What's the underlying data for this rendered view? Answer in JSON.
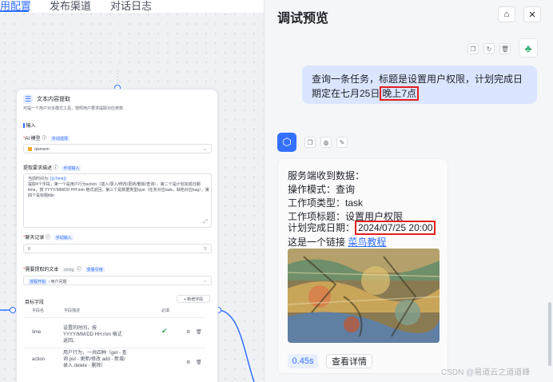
{
  "nav": {
    "tabs": [
      "用配置",
      "发布渠道",
      "对话日志"
    ]
  },
  "node": {
    "title": "文本内容提取",
    "description": "可提一个用户对多模式工具，按照用户要求提取对应参数",
    "input_label": "输入",
    "model_label": "AI 模型",
    "manual_select_tag": "手动选择",
    "model_value": "qianwen",
    "requirement_label": "提取要求描述",
    "manual_input_tag": "手动输入",
    "prompt_prefix": "当前时间为:",
    "prompt_var": "{{sTime}}",
    "prompt_body": "提取4个字段，第一个是用户行为action（插入/录入/修改/更新/删除/查询），第二个是计划完成日期time，按 YYYY/MM/DD HH:mm 格式返回，第三个是数据类型type（任务对应task，缺陷对应bug），第四个是标题title",
    "history_label": "聊天记录",
    "history_tag": "手动输入",
    "history_value": "0",
    "text_label": "需要提取的文本",
    "string_tag": "string",
    "var_ref_tag": "变量引用",
    "text_value_prefix": "流程开始",
    "text_value_suffix": "用户问题",
    "fields_label": "目标字段",
    "add_field_button": "+ 新增字段",
    "table_headers": [
      "字段名",
      "字段描述",
      "必填"
    ],
    "rows": [
      {
        "name": "time",
        "desc": "设置的时间，按 YYYY/MM/DD HH:mm 格式返回。",
        "required": "✔"
      },
      {
        "name": "action",
        "desc": "用户行为，一共四种（get - 查询 put - 更新/修改 add - 新增/录入 delete - 删除）",
        "required": ""
      }
    ]
  },
  "panel": {
    "title": "调试预览",
    "user_message_pre": "查询一条任务，标题是设置用户权限，计划完成日期定在七月25日",
    "user_message_highlight": "晚上7点",
    "bot_lines": [
      "服务端收到数据：",
      "操作模式：查询",
      "工作项类型：task",
      "工作项标题：设置用户权限"
    ],
    "date_label": "计划完成日期：",
    "date_value": "2024/07/25 20:00",
    "link_prefix": "这是一个链接 ",
    "link_text": "菜鸟教程",
    "time_badge": "0.45s",
    "detail_button": "查看详情"
  },
  "watermark": "CSDN @易道云之道道峰",
  "colors": {
    "accent": "#3370ff",
    "highlight": "#e02020",
    "user_bubble": "#dbe5ff"
  }
}
